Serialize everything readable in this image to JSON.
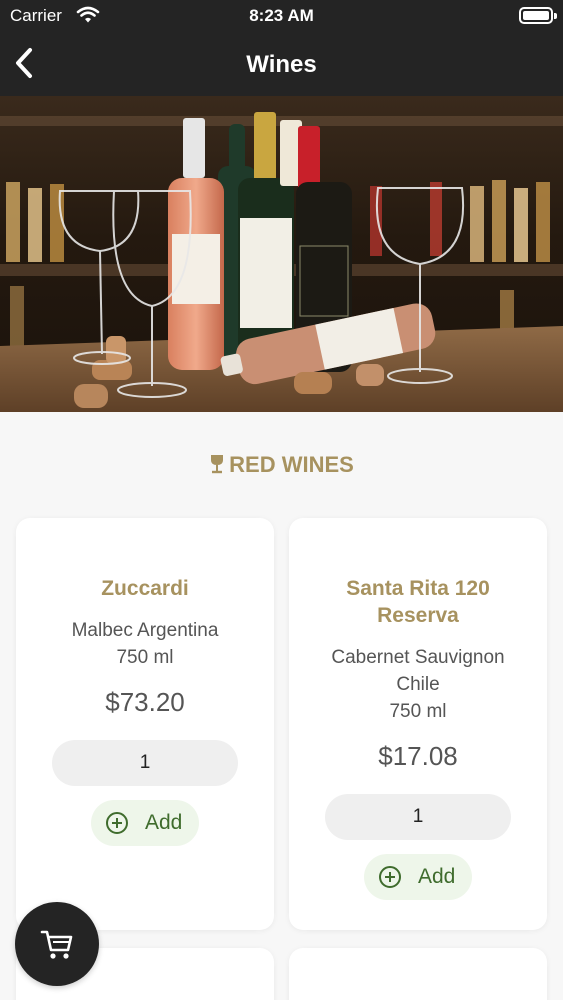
{
  "status_bar": {
    "carrier": "Carrier",
    "time": "8:23 AM"
  },
  "nav": {
    "title": "Wines"
  },
  "section": {
    "heading": "RED WINES"
  },
  "products": [
    {
      "name": "Zuccardi",
      "desc": "Malbec Argentina",
      "volume": "750 ml",
      "price": "$73.20",
      "qty": "1",
      "add_label": "Add"
    },
    {
      "name_line1": "Santa Rita 120",
      "name_line2": "Reserva",
      "desc_line1": "Cabernet Sauvignon",
      "desc_line2": "Chile",
      "volume": "750 ml",
      "price": "$17.08",
      "qty": "1",
      "add_label": "Add"
    }
  ],
  "colors": {
    "bar": "#242424",
    "accent_gold": "#a7925f",
    "add_green": "#3f6c2d",
    "add_bg": "#eef6ea"
  },
  "icons": [
    "wifi-icon",
    "battery-icon",
    "back-chevron-icon",
    "wine-glass-icon",
    "add-circle-icon",
    "cart-icon"
  ]
}
